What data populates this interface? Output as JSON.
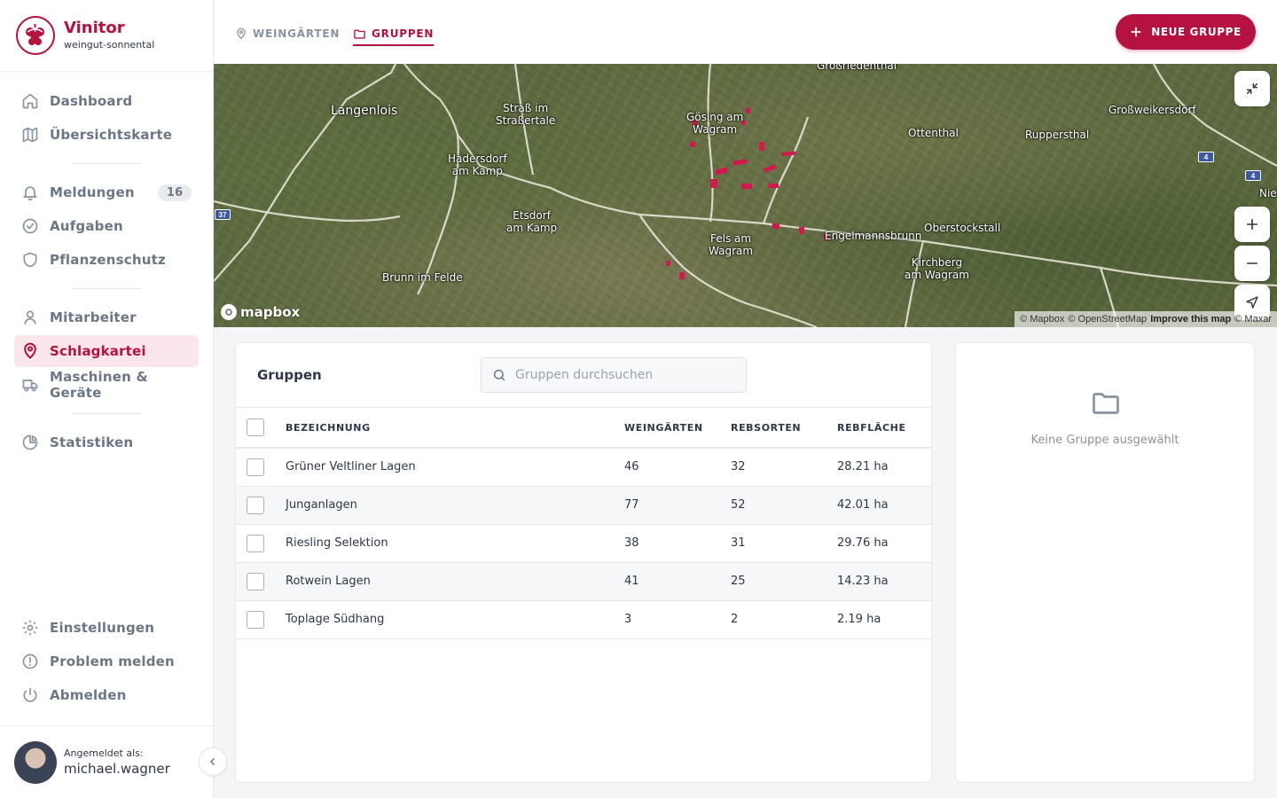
{
  "brand": {
    "name": "Vinitor",
    "tenant": "weingut-sonnental"
  },
  "sidebar": {
    "items": [
      {
        "label": "Dashboard",
        "icon": "home-icon"
      },
      {
        "label": "Übersichtskarte",
        "icon": "map-icon"
      },
      {
        "label": "Meldungen",
        "icon": "bell-icon",
        "badge": "16"
      },
      {
        "label": "Aufgaben",
        "icon": "check-circle-icon"
      },
      {
        "label": "Pflanzenschutz",
        "icon": "shield-icon"
      },
      {
        "label": "Mitarbeiter",
        "icon": "user-icon"
      },
      {
        "label": "Schlagkartei",
        "icon": "map-pin-icon",
        "active": true
      },
      {
        "label": "Maschinen & Geräte",
        "icon": "truck-icon"
      },
      {
        "label": "Statistiken",
        "icon": "pie-chart-icon"
      }
    ],
    "bottom_items": [
      {
        "label": "Einstellungen",
        "icon": "gear-icon"
      },
      {
        "label": "Problem melden",
        "icon": "alert-circle-icon"
      },
      {
        "label": "Abmelden",
        "icon": "power-icon"
      }
    ],
    "user": {
      "caption": "Angemeldet als:",
      "name": "michael.wagner"
    }
  },
  "header": {
    "tabs": [
      {
        "label": "WEINGÄRTEN",
        "icon": "map-pin-icon",
        "active": false
      },
      {
        "label": "GRUPPEN",
        "icon": "folder-icon",
        "active": true
      }
    ],
    "new_button": "NEUE GRUPPE"
  },
  "map": {
    "labels": [
      "Großriedenthal",
      "Langenlois",
      "Straß im\nStraßertale",
      "Gösing am\nWagram",
      "Ottenthal",
      "Ruppersthal",
      "Großweikersdorf",
      "Hadersdorf\nam Kamp",
      "Etsdorf\nam Kamp",
      "Fels am\nWagram",
      "Engelmannsbrunn",
      "Oberstockstall",
      "Kirchberg\nam Wagram",
      "Brunn im Felde",
      "Nie"
    ],
    "road_shields": [
      "37",
      "4",
      "4"
    ],
    "logo": "mapbox",
    "attribution": {
      "mapbox": "© Mapbox",
      "osm": "© OpenStreetMap",
      "improve": "Improve this map",
      "maxar": "© Maxar"
    }
  },
  "groups": {
    "title": "Gruppen",
    "search_placeholder": "Gruppen durchsuchen",
    "columns": [
      "BEZEICHNUNG",
      "WEINGÄRTEN",
      "REBSORTEN",
      "REBFLÄCHE"
    ],
    "rows": [
      {
        "name": "Grüner Veltliner Lagen",
        "vineyards": "46",
        "varieties": "32",
        "area": "28.21 ha"
      },
      {
        "name": "Junganlagen",
        "vineyards": "77",
        "varieties": "52",
        "area": "42.01 ha"
      },
      {
        "name": "Riesling Selektion",
        "vineyards": "38",
        "varieties": "31",
        "area": "29.76 ha"
      },
      {
        "name": "Rotwein Lagen",
        "vineyards": "41",
        "varieties": "25",
        "area": "14.23 ha"
      },
      {
        "name": "Toplage Südhang",
        "vineyards": "3",
        "varieties": "2",
        "area": "2.19 ha"
      }
    ]
  },
  "detail": {
    "empty_text": "Keine Gruppe ausgewählt"
  },
  "colors": {
    "accent": "#b5123f",
    "accent_light": "#fbe6ec",
    "muted_text": "#6b7686",
    "parcel_highlight": "#d1184f"
  }
}
